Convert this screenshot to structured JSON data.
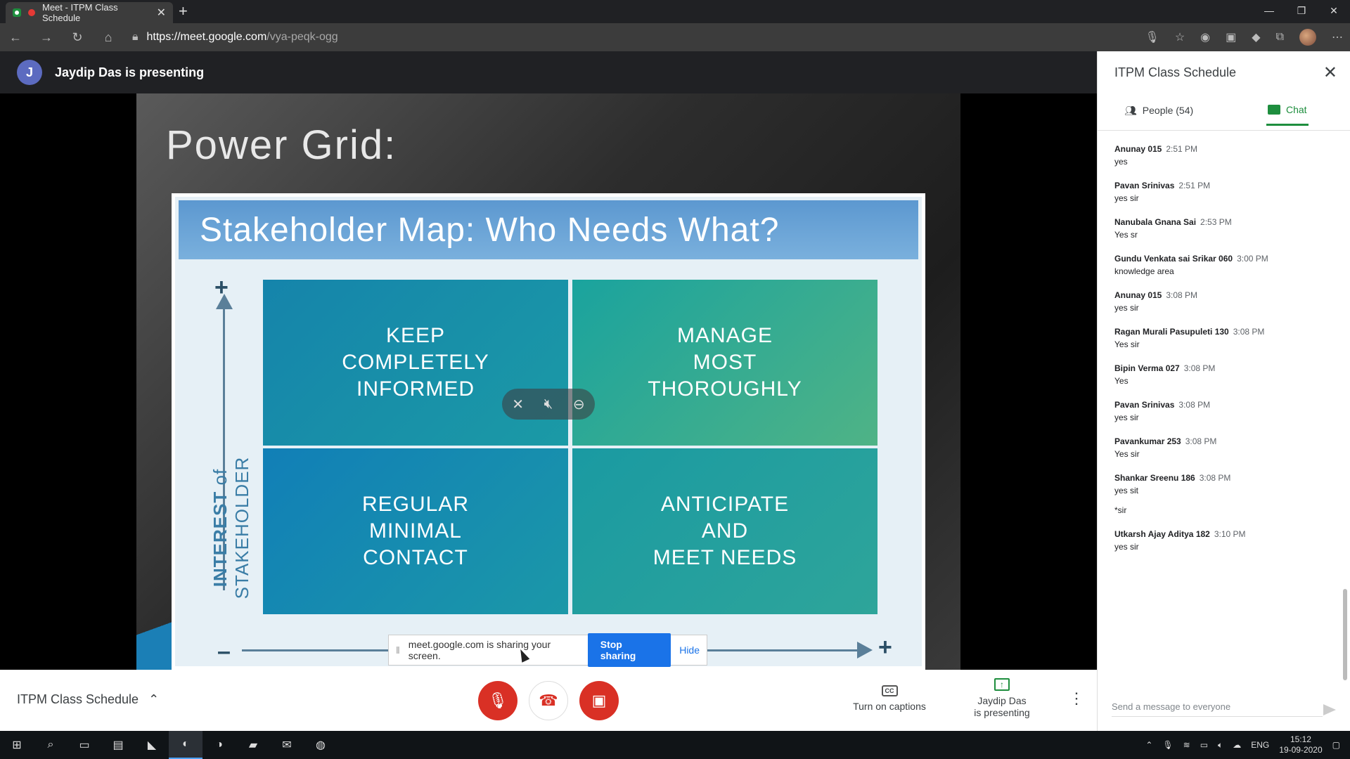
{
  "browser": {
    "tab_title": "Meet - ITPM Class Schedule",
    "url_host": "https://meet.google.com",
    "url_path": "/vya-peqk-ogg"
  },
  "presenting_bar": {
    "avatar_letter": "J",
    "text": "Jaydip Das is presenting"
  },
  "slide": {
    "title": "Power Grid:",
    "card_title": "Stakeholder Map: Who Needs What?",
    "quadrants": [
      "KEEP\nCOMPLETELY\nINFORMED",
      "MANAGE\nMOST\nTHOROUGHLY",
      "REGULAR\nMINIMAL\nCONTACT",
      "ANTICIPATE\nAND\nMEET NEEDS"
    ],
    "y_axis_bold": "INTEREST",
    "y_axis_rest": " of STAKEHOLDER",
    "plus": "+",
    "minus": "–"
  },
  "share_notice": {
    "text": "meet.google.com is sharing your screen.",
    "stop_label": "Stop sharing",
    "hide_label": "Hide"
  },
  "controls": {
    "meeting_name": "ITPM Class Schedule",
    "captions_label": "Turn on captions",
    "captions_icon_text": "CC",
    "presenting_label": "Jaydip Das\nis presenting"
  },
  "side_panel": {
    "title": "ITPM Class Schedule",
    "people_tab": "People (54)",
    "chat_tab": "Chat",
    "compose_placeholder": "Send a message to everyone",
    "messages": [
      {
        "sender": "Anunay 015",
        "time": "2:51 PM",
        "text": "yes"
      },
      {
        "sender": "Pavan Srinivas",
        "time": "2:51 PM",
        "text": "yes sir"
      },
      {
        "sender": "Nanubala Gnana Sai",
        "time": "2:53 PM",
        "text": "Yes sr"
      },
      {
        "sender": "Gundu Venkata sai Srikar 060",
        "time": "3:00 PM",
        "text": "knowledge area"
      },
      {
        "sender": "Anunay 015",
        "time": "3:08 PM",
        "text": "yes sir"
      },
      {
        "sender": "Ragan Murali Pasupuleti 130",
        "time": "3:08 PM",
        "text": "Yes sir"
      },
      {
        "sender": "Bipin Verma 027",
        "time": "3:08 PM",
        "text": "Yes"
      },
      {
        "sender": "Pavan Srinivas",
        "time": "3:08 PM",
        "text": "yes sir"
      },
      {
        "sender": "Pavankumar 253",
        "time": "3:08 PM",
        "text": "Yes sir"
      },
      {
        "sender": "Shankar Sreenu 186",
        "time": "3:08 PM",
        "text": "yes sit",
        "text2": "*sir"
      },
      {
        "sender": "Utkarsh Ajay Aditya 182",
        "time": "3:10 PM",
        "text": "yes sir"
      }
    ]
  },
  "taskbar": {
    "language": "ENG",
    "time": "15:12",
    "date": "19-09-2020"
  }
}
